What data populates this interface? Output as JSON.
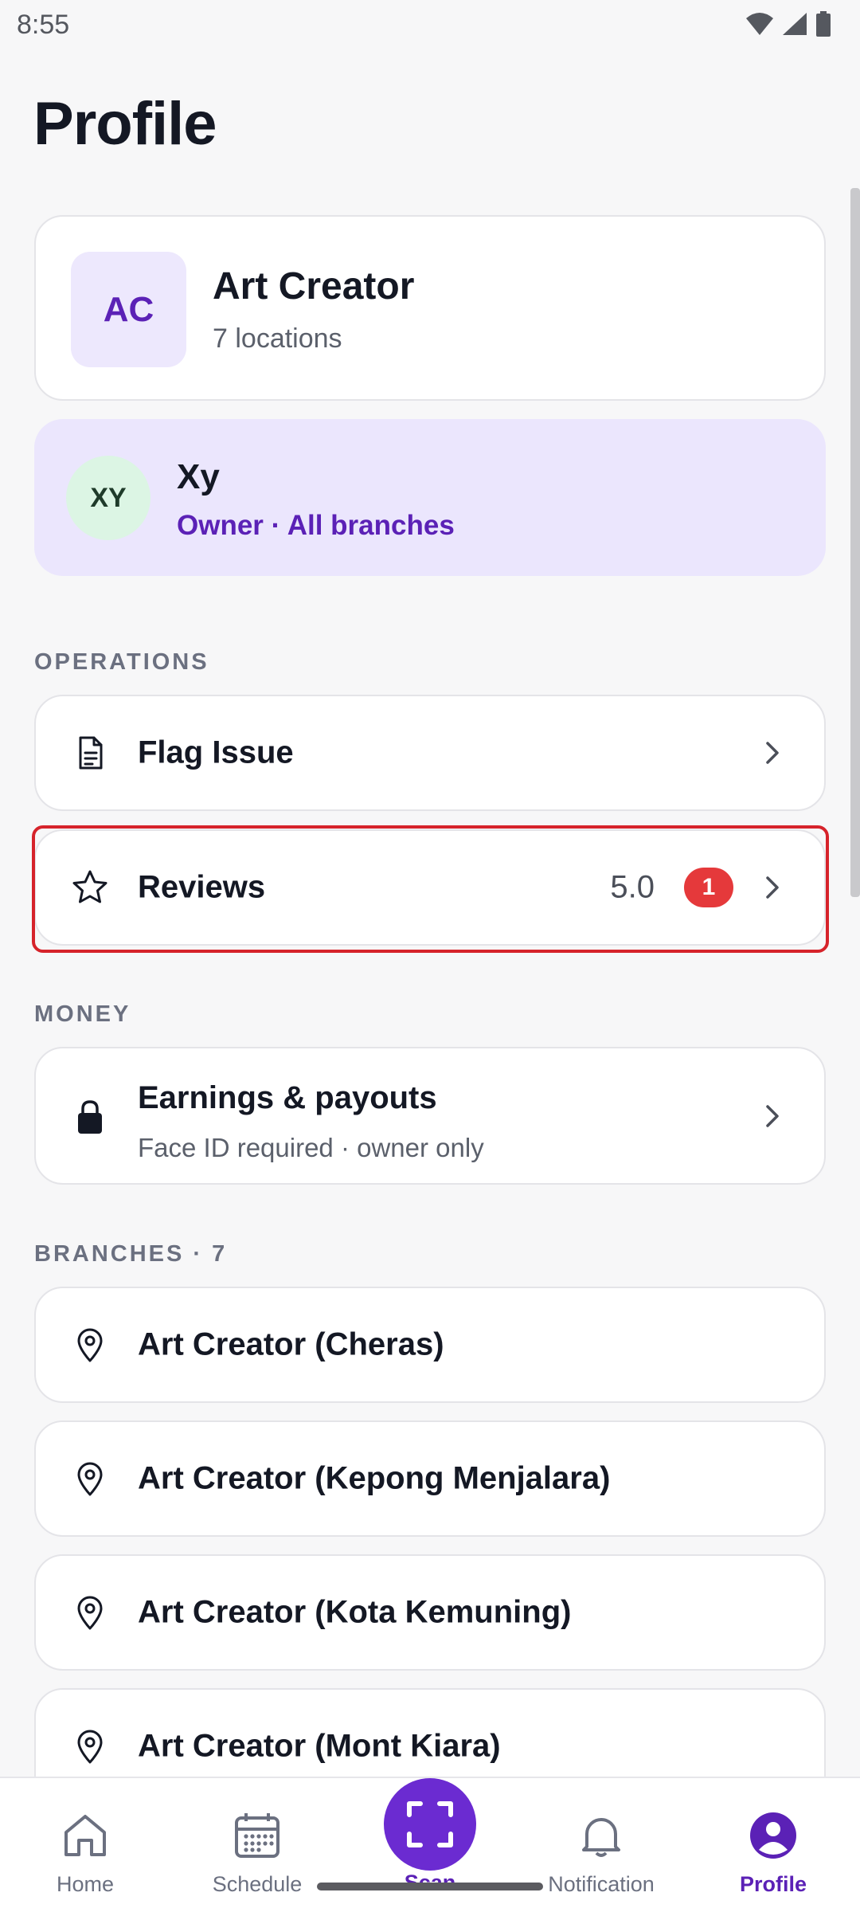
{
  "status_bar": {
    "time": "8:55"
  },
  "page": {
    "title": "Profile"
  },
  "organization": {
    "initials": "AC",
    "name": "Art Creator",
    "subtitle": "7 locations"
  },
  "user": {
    "initials": "XY",
    "name": "Xy",
    "role": "Owner · All branches"
  },
  "sections": {
    "operations": {
      "header": "OPERATIONS",
      "items": [
        {
          "label": "Flag Issue",
          "icon": "document-icon"
        },
        {
          "label": "Reviews",
          "icon": "star-icon",
          "value": "5.0",
          "badge": "1"
        }
      ]
    },
    "money": {
      "header": "MONEY",
      "items": [
        {
          "label": "Earnings & payouts",
          "sublabel": "Face ID required · owner only",
          "icon": "lock-icon"
        }
      ]
    },
    "branches": {
      "header": "BRANCHES · 7",
      "items": [
        {
          "label": "Art Creator (Cheras)",
          "icon": "location-pin-icon"
        },
        {
          "label": "Art Creator (Kepong Menjalara)",
          "icon": "location-pin-icon"
        },
        {
          "label": "Art Creator (Kota Kemuning)",
          "icon": "location-pin-icon"
        },
        {
          "label": "Art Creator (Mont Kiara)",
          "icon": "location-pin-icon"
        }
      ]
    }
  },
  "bottom_nav": {
    "items": [
      {
        "label": "Home",
        "icon": "home-icon"
      },
      {
        "label": "Schedule",
        "icon": "calendar-icon"
      },
      {
        "label": "Scan",
        "icon": "scan-icon"
      },
      {
        "label": "Notification",
        "icon": "bell-icon"
      },
      {
        "label": "Profile",
        "icon": "user-icon",
        "active": true
      }
    ]
  },
  "colors": {
    "accent": "#5b21b6",
    "accent_fill": "#6b2bd1",
    "badge": "#e5393b",
    "highlight": "#d6232b"
  }
}
